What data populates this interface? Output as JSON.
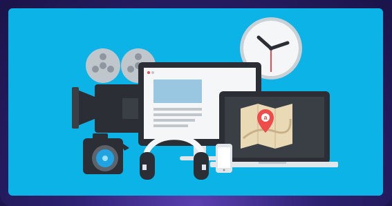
{
  "illustration": {
    "theme_colors": {
      "panel": "#0bb3e6",
      "frame": "#2a1f66",
      "dark": "#2b2f35",
      "grey": "#bfc6cc",
      "white": "#f4f6f7",
      "accent_red": "#ef4b4b",
      "map_tan": "#e9d9b5"
    },
    "icons": [
      "film-projector-icon",
      "video-camera-icon",
      "photo-camera-icon",
      "desktop-monitor-icon",
      "headphones-icon",
      "laptop-icon",
      "map-icon",
      "location-pin-icon",
      "smartphone-icon",
      "wall-clock-icon"
    ],
    "pin_letter": "a"
  }
}
